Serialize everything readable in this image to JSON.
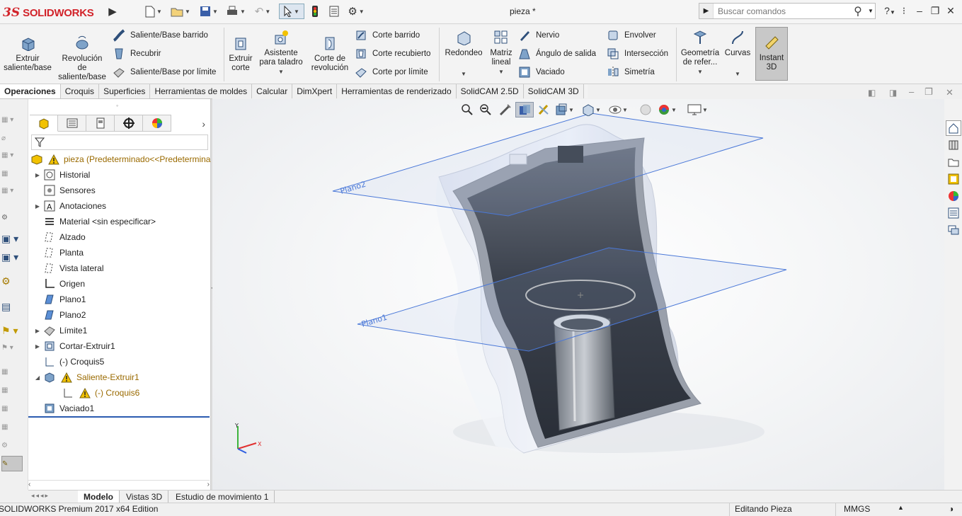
{
  "app": {
    "logo_prefix": "3S",
    "logo_brand": "SOLIDWORKS",
    "doc_title": "pieza *"
  },
  "search": {
    "placeholder": "Buscar comandos"
  },
  "ribbon": {
    "extrude": "Extruir saliente/base",
    "revolve": "Revolución de saliente/base",
    "swept": "Saliente/Base barrido",
    "loft": "Recubrir",
    "boundary": "Saliente/Base por límite",
    "extruded_cut": "Extruir corte",
    "hole_wizard": "Asistente para taladro",
    "revolved_cut": "Corte de revolución",
    "swept_cut": "Corte barrido",
    "lofted_cut": "Corte recubierto",
    "boundary_cut": "Corte por límite",
    "fillet": "Redondeo",
    "linear_pattern": "Matriz lineal",
    "rib": "Nervio",
    "draft": "Ángulo de salida",
    "shell": "Vaciado",
    "wrap": "Envolver",
    "intersect": "Intersección",
    "mirror": "Simetría",
    "ref_geometry": "Geometría de refer...",
    "curves": "Curvas",
    "instant3d": "Instant 3D"
  },
  "tabs": [
    "Operaciones",
    "Croquis",
    "Superficies",
    "Herramientas de moldes",
    "Calcular",
    "DimXpert",
    "Herramientas de renderizado",
    "SolidCAM 2.5D",
    "SolidCAM 3D"
  ],
  "tree": {
    "root": "pieza  (Predeterminado<<Predetermina",
    "items": [
      {
        "label": "Historial"
      },
      {
        "label": "Sensores"
      },
      {
        "label": "Anotaciones"
      },
      {
        "label": "Material <sin especificar>"
      },
      {
        "label": "Alzado"
      },
      {
        "label": "Planta"
      },
      {
        "label": "Vista lateral"
      },
      {
        "label": "Origen"
      },
      {
        "label": "Plano1"
      },
      {
        "label": "Plano2"
      },
      {
        "label": "Límite1"
      },
      {
        "label": "Cortar-Extruir1"
      },
      {
        "label": "(-) Croquis5"
      },
      {
        "label": "Saliente-Extruir1"
      },
      {
        "label": "(-) Croquis6"
      },
      {
        "label": "Vaciado1"
      }
    ]
  },
  "viewport": {
    "plane2_label": "Plano2",
    "plane1_label": "Plano1",
    "triad": {
      "y": "Y",
      "x": "X"
    }
  },
  "bottom_tabs": [
    "Modelo",
    "Vistas 3D",
    "Estudio de movimiento 1"
  ],
  "status": {
    "left": "SOLIDWORKS Premium 2017 x64 Edition",
    "mode": "Editando Pieza",
    "units": "MMGS"
  },
  "colors": {
    "accent": "#d2232a",
    "plane": "#4a78d8",
    "warning": "#e8b400"
  }
}
